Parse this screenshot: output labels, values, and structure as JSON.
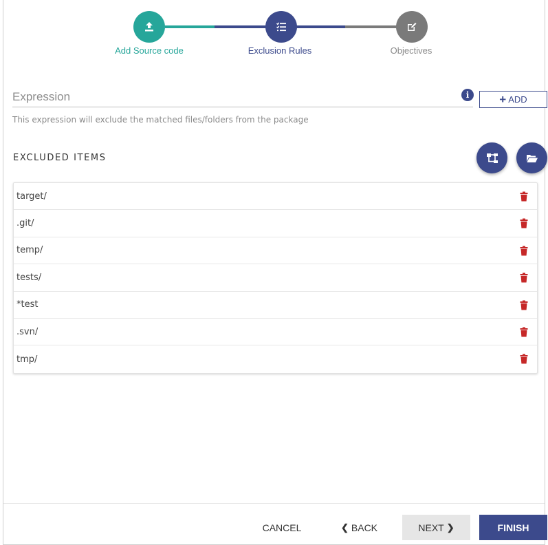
{
  "stepper": {
    "steps": [
      {
        "label": "Add Source code",
        "icon": "upload-icon",
        "color": "#26a69a"
      },
      {
        "label": "Exclusion Rules",
        "icon": "checklist-icon",
        "color": "#3c4a8c"
      },
      {
        "label": "Objectives",
        "icon": "edit-icon",
        "color": "#7a7a7a"
      }
    ]
  },
  "expression": {
    "placeholder": "Expression",
    "value": "",
    "add_label": "ADD",
    "helper": "This expression will exclude the matched files/folders from the package"
  },
  "excluded": {
    "title": "EXCLUDED ITEMS",
    "items": [
      "target/",
      ".git/",
      "temp/",
      "tests/",
      "*test",
      ".svn/",
      "tmp/"
    ]
  },
  "footer": {
    "cancel": "CANCEL",
    "back": "BACK",
    "next": "NEXT",
    "finish": "FINISH"
  },
  "colors": {
    "primary": "#3c4a8c",
    "teal": "#26a69a",
    "gray": "#7a7a7a",
    "danger": "#c62828"
  }
}
